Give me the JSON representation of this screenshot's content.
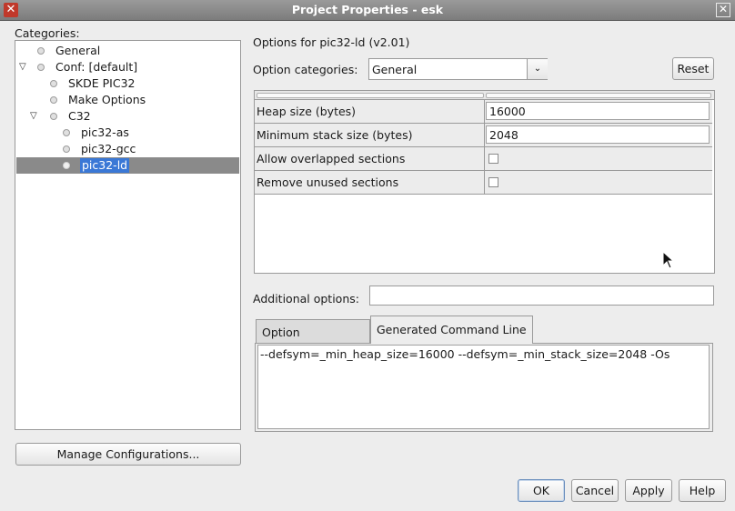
{
  "window": {
    "title": "Project Properties - esk"
  },
  "categories": {
    "label": "Categories:",
    "items": [
      {
        "label": "General"
      },
      {
        "label": "Conf: [default]"
      },
      {
        "label": "SKDE PIC32"
      },
      {
        "label": "Make Options"
      },
      {
        "label": "C32"
      },
      {
        "label": "pic32-as"
      },
      {
        "label": "pic32-gcc"
      },
      {
        "label": "pic32-ld"
      }
    ],
    "manage_label": "Manage Configurations..."
  },
  "options": {
    "heading": "Options for pic32-ld (v2.01)",
    "category_label": "Option categories:",
    "category_value": "General",
    "reset_label": "Reset",
    "rows": [
      {
        "label": "Heap size (bytes)",
        "value": "16000"
      },
      {
        "label": "Minimum stack size (bytes)",
        "value": "2048"
      },
      {
        "label": "Allow overlapped sections"
      },
      {
        "label": "Remove unused sections"
      }
    ],
    "additional_label": "Additional options:",
    "additional_value": ""
  },
  "tabs": [
    {
      "label": "Option Description"
    },
    {
      "label": "Generated Command Line"
    }
  ],
  "command_line": "--defsym=_min_heap_size=16000 --defsym=_min_stack_size=2048 -Os",
  "buttons": {
    "ok": "OK",
    "cancel": "Cancel",
    "apply": "Apply",
    "help": "Help"
  },
  "colors": {
    "selection": "#8a8a8a",
    "selected_text_bg": "#3a78d6"
  }
}
